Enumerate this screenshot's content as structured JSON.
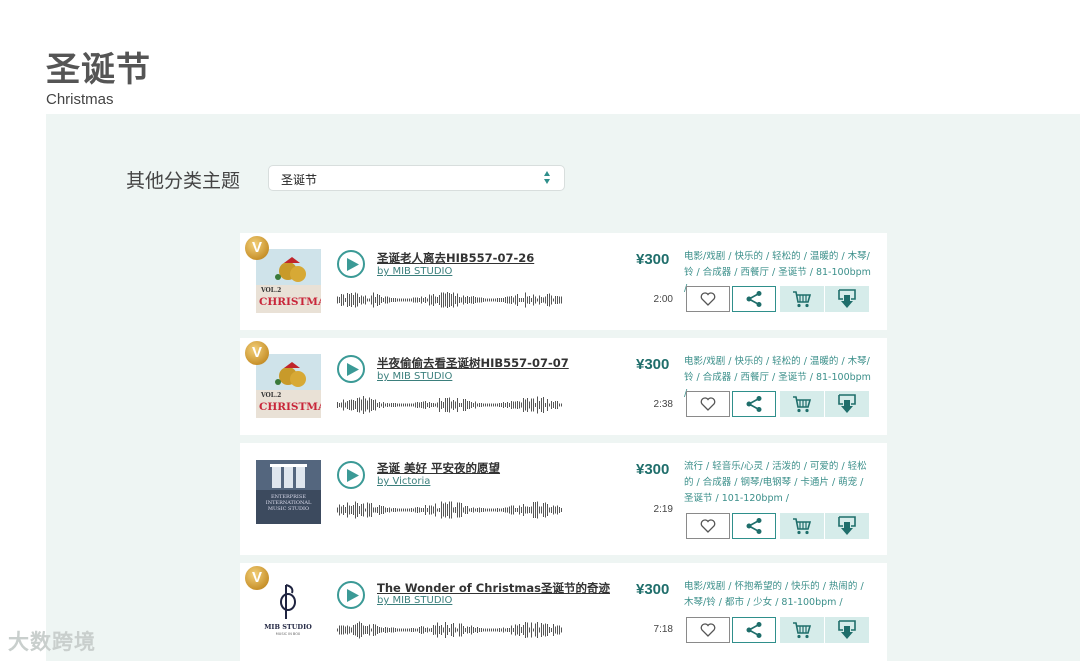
{
  "page": {
    "title": "圣诞节",
    "subtitle": "Christmas"
  },
  "filter": {
    "label": "其他分类主题",
    "selected": "圣诞节"
  },
  "tracks": [
    {
      "title": "圣诞老人离去HIB557-07-26",
      "artist": "by MIB STUDIO",
      "price": "¥300",
      "duration": "2:00",
      "tags": "电影/戏剧 / 快乐的 / 轻松的 / 温暖的 / 木琴/铃 / 合成器 / 西餐厅 / 圣诞节 / 81-100bpm /",
      "vip": "V",
      "cover": "christmas-vol2"
    },
    {
      "title": "半夜偷偷去看圣诞树HIB557-07-07",
      "artist": "by MIB STUDIO",
      "price": "¥300",
      "duration": "2:38",
      "tags": "电影/戏剧 / 快乐的 / 轻松的 / 温暖的 / 木琴/铃 / 合成器 / 西餐厅 / 圣诞节 / 81-100bpm /",
      "vip": "V",
      "cover": "christmas-vol2"
    },
    {
      "title": "圣诞 美好 平安夜的愿望",
      "artist": "by Victoria",
      "price": "¥300",
      "duration": "2:19",
      "tags": "流行 / 轻音乐/心灵 / 活泼的 / 可爱的 / 轻松的 / 合成器 / 钢琴/电钢琴 / 卡通片 / 萌宠 / 圣诞节 / 101-120bpm /",
      "vip": "",
      "cover": "enterprise-music"
    },
    {
      "title": "The Wonder of Christmas圣诞节的奇迹",
      "artist": "by MIB STUDIO",
      "price": "¥300",
      "duration": "7:18",
      "tags": "电影/戏剧 / 怀抱希望的 / 快乐的 / 热闹的 / 木琴/铃 / 都市 / 少女 / 81-100bpm /",
      "vip": "V",
      "cover": "mib-studio-logo"
    }
  ],
  "covers": {
    "christmas_text": "CHRISTMAS",
    "vol_text": "VOL.2",
    "enterprise_text": "ENTERPRISE INTERNATIONAL MUSIC STUDIO",
    "mib_text": "MIB STUDIO",
    "mib_sub": "MUSIC IN BOX"
  },
  "watermark": "大数跨境",
  "icons": [
    "play-icon",
    "heart-icon",
    "share-icon",
    "cart-icon",
    "download-icon",
    "select-arrows-icon"
  ],
  "colors": {
    "accent": "#1f6e6b",
    "teal": "#3b9a96",
    "panel_bg": "#eef5f3",
    "action_bg": "#d6ecea",
    "tag_text": "#3b8f8a"
  }
}
